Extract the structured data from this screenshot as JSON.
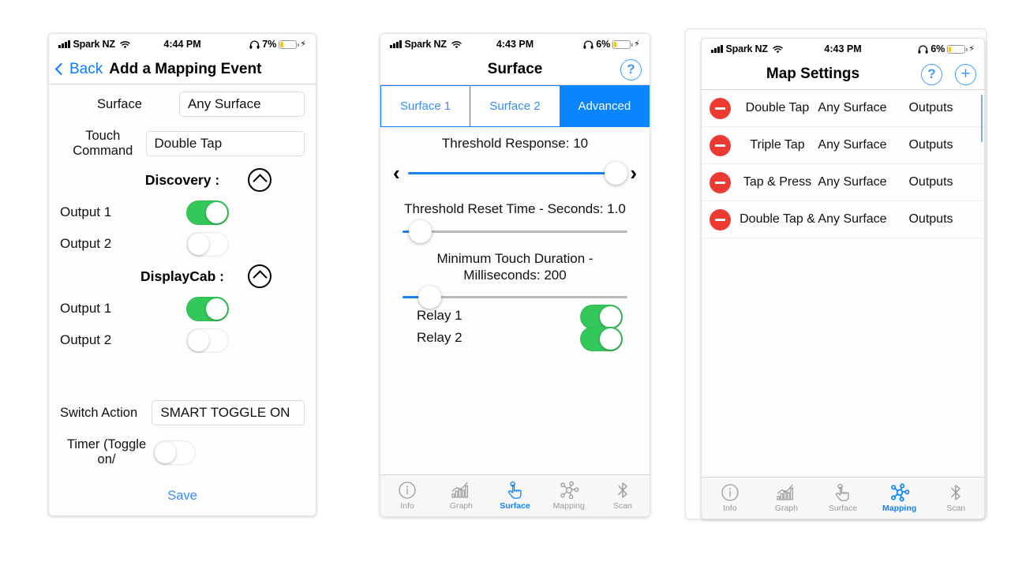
{
  "phone1": {
    "status": {
      "carrier": "Spark NZ",
      "time": "4:44 PM",
      "battery_pct": "7%",
      "wifi_icon": "wifi-icon",
      "headphones_icon": "headphones-icon",
      "charging_icon": "lightning-bolt-icon"
    },
    "nav": {
      "back_label": "Back",
      "title": "Add a Mapping Event"
    },
    "fields": [
      {
        "label": "Surface",
        "value": "Any Surface"
      },
      {
        "label": "Touch Command",
        "value": "Double Tap"
      }
    ],
    "sections": [
      {
        "title": "Discovery :",
        "collapse_icon": "chevron-up-circle-icon",
        "rows": [
          {
            "label": "Output 1",
            "state": "on"
          },
          {
            "label": "Output 2",
            "state": "off"
          }
        ]
      },
      {
        "title": "DisplayCab :",
        "collapse_icon": "chevron-up-circle-icon",
        "rows": [
          {
            "label": "Output 1",
            "state": "on"
          },
          {
            "label": "Output 2",
            "state": "off"
          }
        ]
      }
    ],
    "switch_action": {
      "label": "Switch Action",
      "value": "SMART TOGGLE ON"
    },
    "timer": {
      "label": "Timer (Toggle on/",
      "state": "off"
    },
    "save_label": "Save"
  },
  "phone2": {
    "status": {
      "carrier": "Spark NZ",
      "time": "4:43 PM",
      "battery_pct": "6%",
      "wifi_icon": "wifi-icon",
      "headphones_icon": "headphones-icon",
      "charging_icon": "lightning-bolt-icon"
    },
    "nav": {
      "title": "Surface",
      "help_label": "?"
    },
    "segments": [
      {
        "label": "Surface 1",
        "active": false
      },
      {
        "label": "Surface 2",
        "active": false
      },
      {
        "label": "Advanced",
        "active": true
      }
    ],
    "sliders": [
      {
        "caption": "Threshold Response: 10",
        "value": 10,
        "percent": 97,
        "has_arrows": true,
        "left_arrow": "‹",
        "right_arrow": "›"
      },
      {
        "caption": "Threshold Reset Time - Seconds: 1.0",
        "value": 1.0,
        "percent": 8,
        "has_arrows": false
      },
      {
        "caption": "Minimum Touch Duration - Milliseconds: 200",
        "value": 200,
        "percent": 12,
        "has_arrows": false
      }
    ],
    "relays": [
      {
        "label": "Relay 1",
        "state": "on"
      },
      {
        "label": "Relay 2",
        "state": "on"
      }
    ],
    "tabs": [
      {
        "label": "Info",
        "icon": "info-circle-icon",
        "active": false
      },
      {
        "label": "Graph",
        "icon": "bar-chart-icon",
        "active": false
      },
      {
        "label": "Surface",
        "icon": "tap-hand-icon",
        "active": true
      },
      {
        "label": "Mapping",
        "icon": "network-nodes-icon",
        "active": false
      },
      {
        "label": "Scan",
        "icon": "bluetooth-icon",
        "active": false
      }
    ]
  },
  "phone3": {
    "status": {
      "carrier": "Spark NZ",
      "time": "4:43 PM",
      "battery_pct": "6%",
      "wifi_icon": "wifi-icon",
      "headphones_icon": "headphones-icon",
      "charging_icon": "lightning-bolt-icon"
    },
    "nav": {
      "title": "Map Settings",
      "help_label": "?",
      "add_label": "+"
    },
    "rows": [
      {
        "delete_icon": "minus-circle-icon",
        "gesture": "Double Tap",
        "surface": "Any Surface",
        "outputs": "Outputs"
      },
      {
        "delete_icon": "minus-circle-icon",
        "gesture": "Triple Tap",
        "surface": "Any Surface",
        "outputs": "Outputs"
      },
      {
        "delete_icon": "minus-circle-icon",
        "gesture": "Tap & Press",
        "surface": "Any Surface",
        "outputs": "Outputs"
      },
      {
        "delete_icon": "minus-circle-icon",
        "gesture": "Double Tap &",
        "surface": "Any Surface",
        "outputs": "Outputs"
      }
    ],
    "tabs": [
      {
        "label": "Info",
        "icon": "info-circle-icon",
        "active": false
      },
      {
        "label": "Graph",
        "icon": "bar-chart-icon",
        "active": false
      },
      {
        "label": "Surface",
        "icon": "tap-hand-icon",
        "active": false
      },
      {
        "label": "Mapping",
        "icon": "network-nodes-icon",
        "active": true
      },
      {
        "label": "Scan",
        "icon": "bluetooth-icon",
        "active": false
      }
    ]
  },
  "colors": {
    "accent": "#0a84ff",
    "toggle_on": "#34c759",
    "delete_red": "#ed3b33",
    "battery_yellow": "#f5c518",
    "link": "#3b8cf6"
  }
}
